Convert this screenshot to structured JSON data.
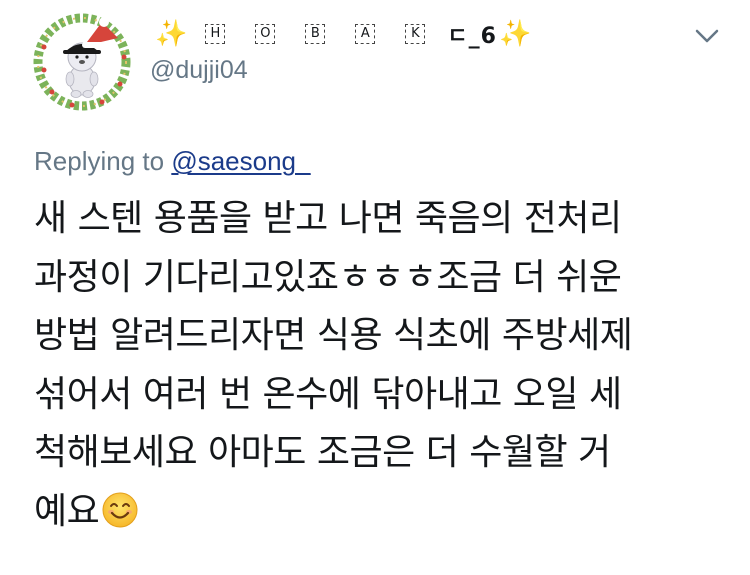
{
  "author": {
    "display_name_prefix_sparkle": "✨",
    "display_name_letters": [
      "H",
      "O",
      "B",
      "A",
      "K"
    ],
    "display_name_suffix": "ㄷ_6",
    "display_name_suffix_sparkle": "✨",
    "handle": "@dujji04"
  },
  "reply": {
    "prefix": "Replying to",
    "mention": "@saesong_"
  },
  "tweet": {
    "lines": [
      "새 스텐 용품을 받고 나면 죽음의 전처리",
      "과정이 기다리고있죠ㅎㅎㅎ조금 더 쉬운",
      "방법 알려드리자면 식용 식초에 주방세제",
      "섞어서 여러 번 온수에 닦아내고 오일 세",
      "척해보세요 아마도 조금은 더 수월할 거",
      "예요"
    ],
    "emoji": "smiling-face-with-smiling-eyes"
  },
  "colors": {
    "text_primary": "#14171a",
    "text_secondary": "#657786",
    "mention": "#1b3b8a",
    "sparkle": "#f5c518",
    "avatar_ring": "#6aa84f",
    "avatar_hat": "#d6453b"
  },
  "icons": {
    "menu": "chevron-down-icon",
    "avatar": "avatar-image"
  }
}
